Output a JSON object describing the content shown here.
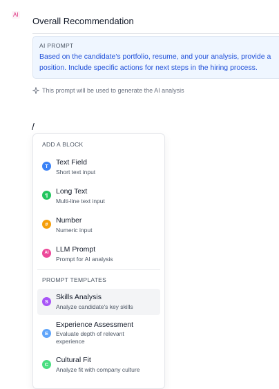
{
  "badge": "AI",
  "section": {
    "title": "Overall Recommendation"
  },
  "prompt": {
    "label": "AI PROMPT",
    "line1": "Based on the candidate's portfolio, resume, and your analysis, provide a",
    "line2": "position. Include specific actions for next steps in the hiring process."
  },
  "hint": {
    "icon": "sparkle-icon",
    "text": "This prompt will be used to generate the AI analysis"
  },
  "editor": {
    "slash": "/"
  },
  "menu": {
    "blocks_heading": "ADD A BLOCK",
    "blocks": [
      {
        "icon_text": "T",
        "color": "#3b82f6",
        "title": "Text Field",
        "desc": "Short text input"
      },
      {
        "icon_text": "¶",
        "color": "#22c55e",
        "title": "Long Text",
        "desc": "Multi-line text input"
      },
      {
        "icon_text": "#",
        "color": "#f59e0b",
        "title": "Number",
        "desc": "Numeric input"
      },
      {
        "icon_text": "AI",
        "color": "#ec4899",
        "title": "LLM Prompt",
        "desc": "Prompt for AI analysis"
      }
    ],
    "templates_heading": "PROMPT TEMPLATES",
    "templates": [
      {
        "icon_text": "S",
        "color": "#a855f7",
        "title": "Skills Analysis",
        "desc": "Analyze candidate's key skills"
      },
      {
        "icon_text": "E",
        "color": "#60a5fa",
        "title": "Experience Assessment",
        "desc": "Evaluate depth of relevant experience"
      },
      {
        "icon_text": "C",
        "color": "#4ade80",
        "title": "Cultural Fit",
        "desc": "Analyze fit with company culture"
      }
    ]
  }
}
